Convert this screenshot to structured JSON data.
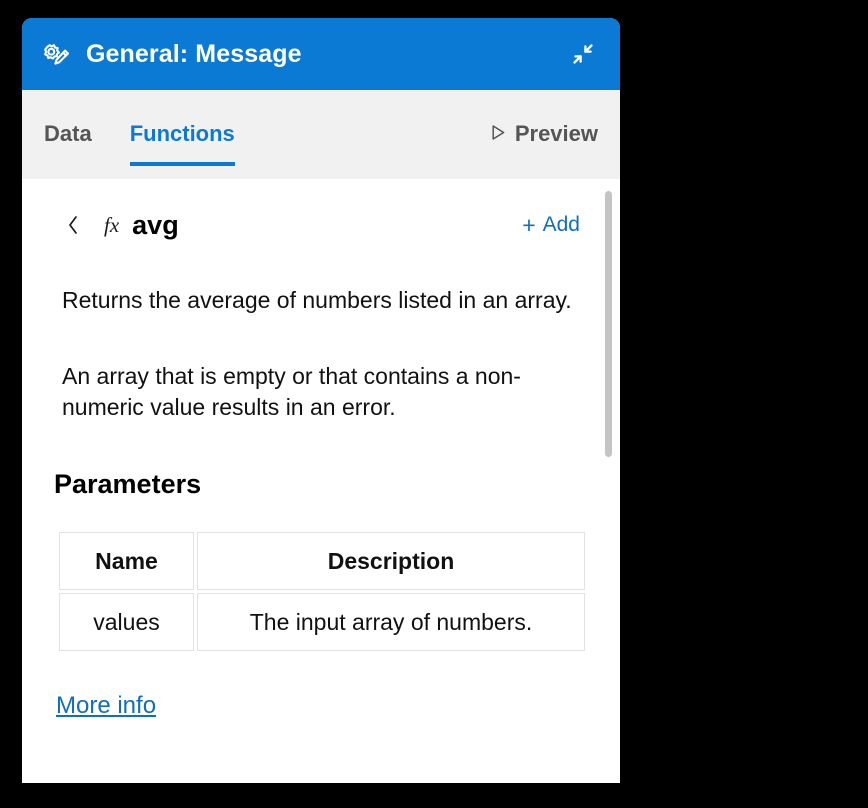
{
  "window": {
    "title": "General: Message",
    "title_icon": "settings-edit-icon",
    "collapse_icon": "collapse-arrows-icon",
    "header_color": "#0b7ad4"
  },
  "tabs": {
    "items": [
      {
        "label": "Data",
        "active": false
      },
      {
        "label": "Functions",
        "active": true
      }
    ],
    "preview": {
      "label": "Preview",
      "icon": "play-triangle-icon"
    }
  },
  "function_panel": {
    "back_icon": "chevron-left-icon",
    "fx_icon": "fx",
    "name": "avg",
    "add_label": "Add",
    "add_plus": "+",
    "description": [
      "Returns the average of numbers listed in an array.",
      "An array that is empty or that contains a non-numeric value results in an error."
    ],
    "parameters_title": "Parameters",
    "parameters_table": {
      "headers": [
        "Name",
        "Description"
      ],
      "rows": [
        [
          "values",
          "The input array of numbers."
        ]
      ]
    },
    "more_info_label": "More info"
  },
  "colors": {
    "accent": "#0b7ad4",
    "link": "#106ebe",
    "tabbar_bg": "#f1f1f1",
    "tab_inactive": "#555555",
    "scrollbar": "#c4c4c4"
  }
}
